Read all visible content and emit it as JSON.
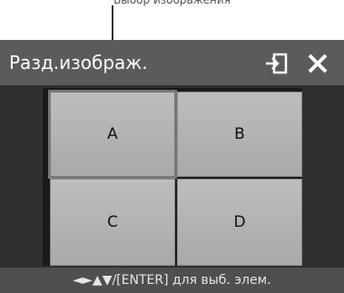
{
  "callout": {
    "label": "Выбор изображения"
  },
  "titlebar": {
    "title": "Разд.изображ.",
    "return_icon": "return-icon",
    "close_icon": "close-icon"
  },
  "grid": {
    "cells": [
      {
        "label": "A",
        "selected": true
      },
      {
        "label": "B",
        "selected": false
      },
      {
        "label": "C",
        "selected": false
      },
      {
        "label": "D",
        "selected": false
      }
    ]
  },
  "footer": {
    "hint": "◄►▲▼/[ENTER] для выб. элем."
  }
}
